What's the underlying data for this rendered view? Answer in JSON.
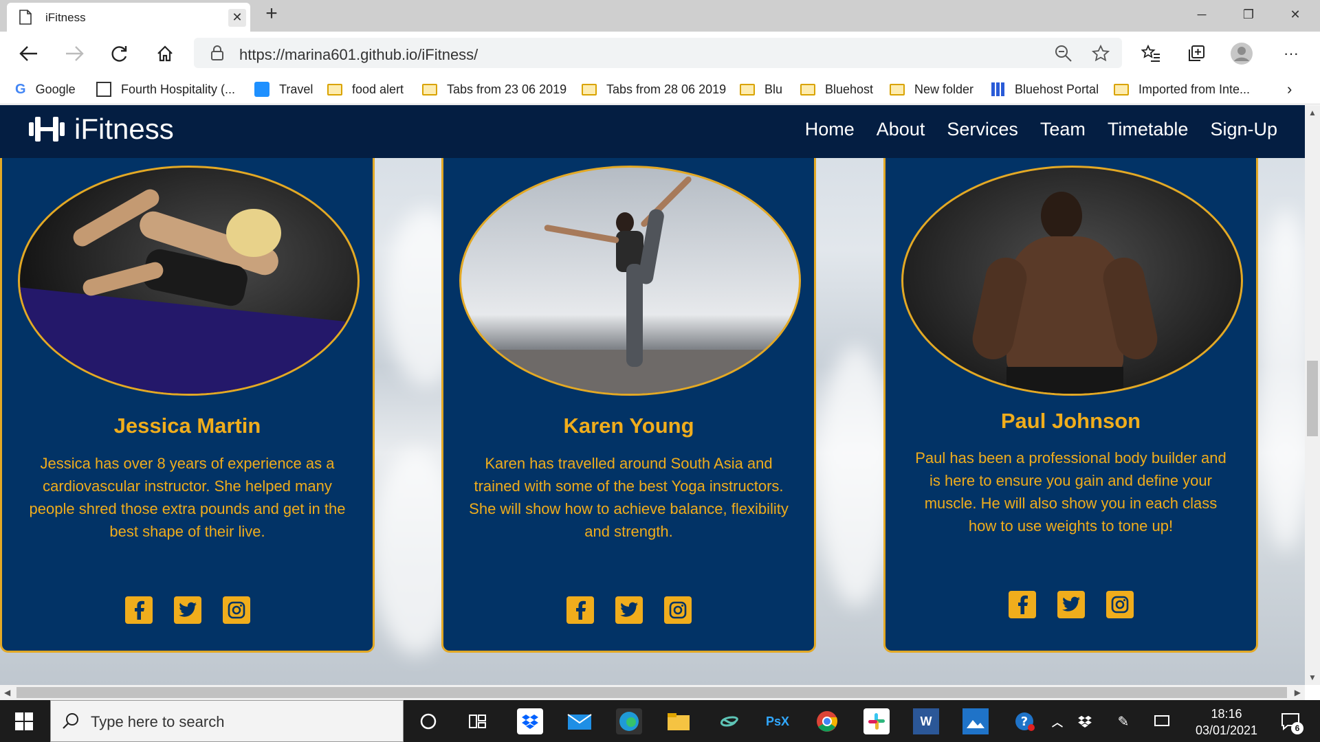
{
  "browser": {
    "tab_title": "iFitness",
    "tab_close": "✕",
    "new_tab": "+",
    "url": "https://marina601.github.io/iFitness/",
    "bookmarks": [
      "Google",
      "Fourth Hospitality (...",
      "Travel",
      "food alert",
      "Tabs from 23 06 2019",
      "Tabs from 28 06 2019",
      "Blu",
      "Bluehost",
      "New folder",
      "Bluehost Portal",
      "Imported from Inte..."
    ]
  },
  "site": {
    "brand": "iFitness",
    "nav": [
      "Home",
      "About",
      "Services",
      "Team",
      "Timetable",
      "Sign-Up"
    ],
    "accent_color": "#f0ad1c",
    "card_color": "#023366"
  },
  "team": [
    {
      "name": "Jessica Martin",
      "bio": "Jessica has over 8 years of experience as a cardiovascular instructor. She helped many people shred those extra pounds and get in the best shape of their live."
    },
    {
      "name": "Karen Young",
      "bio": "Karen has travelled around South Asia and trained with some of the best Yoga instructors. She will show how to achieve balance, flexibility and strength."
    },
    {
      "name": "Paul Johnson",
      "bio": "Paul has been a professional body builder and is here to ensure you gain and define your muscle. He will also show you in each class how to use weights to tone up!"
    }
  ],
  "taskbar": {
    "search_placeholder": "Type here to search",
    "time": "18:16",
    "date": "03/01/2021",
    "notification_count": "6"
  }
}
